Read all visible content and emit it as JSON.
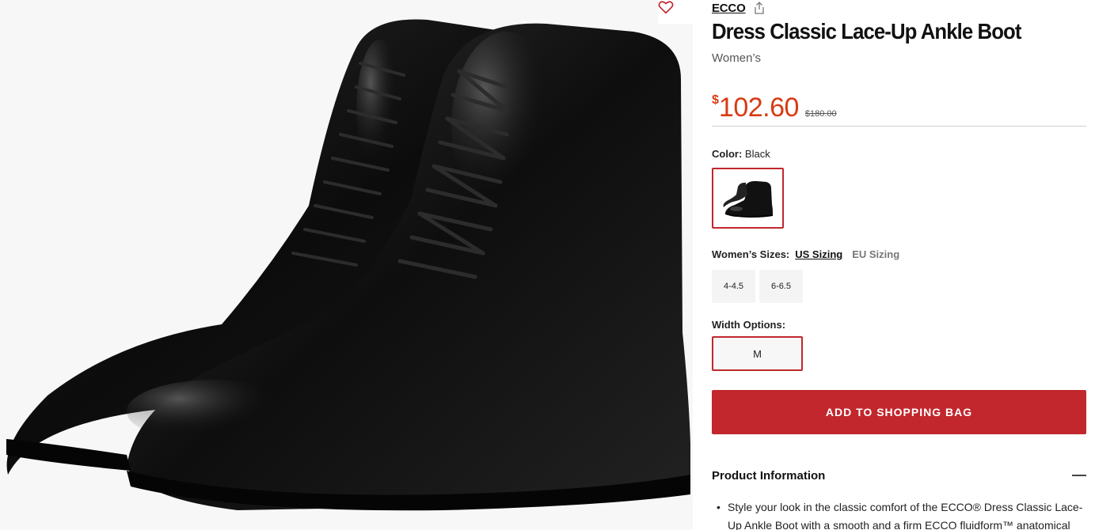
{
  "product": {
    "brand": "ECCO",
    "title": "Dress Classic Lace-Up Ankle Boot",
    "gender": "Women’s",
    "price_currency": "$",
    "price": "102.60",
    "original_price": "$180.00"
  },
  "color": {
    "label": "Color:",
    "value": "Black"
  },
  "sizes": {
    "label": "Women’s Sizes:",
    "systems": [
      "US Sizing",
      "EU Sizing"
    ],
    "options": [
      "4-4.5",
      "6-6.5"
    ]
  },
  "width": {
    "label": "Width Options:",
    "options": [
      "M"
    ]
  },
  "actions": {
    "add_to_bag": "ADD TO SHOPPING BAG"
  },
  "product_info": {
    "title": "Product Information",
    "bullets": [
      "Style your look in the classic comfort of the ECCO® Dress Classic Lace-Up Ankle Boot with a smooth and a firm ECCO fluidform™ anatomical"
    ]
  },
  "colors": {
    "accent": "#c1272d",
    "price": "#d93a14"
  },
  "icons": {
    "favorite": "heart-icon",
    "share": "share-icon",
    "collapse": "minus-icon"
  }
}
